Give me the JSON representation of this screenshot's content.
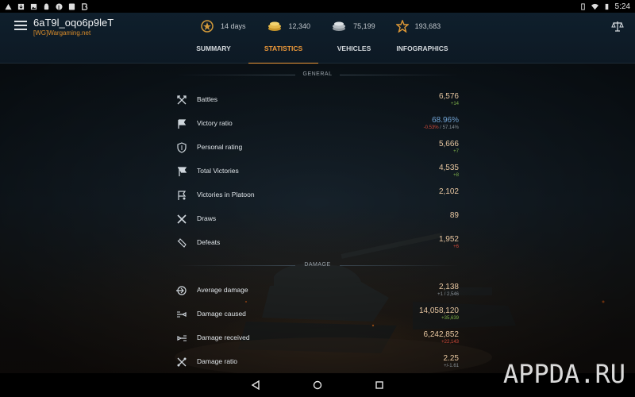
{
  "status_bar": {
    "time": "5:24",
    "icons": [
      "warning-icon",
      "download-icon",
      "image-icon",
      "android-icon",
      "pinterest-icon",
      "file-icon",
      "bitcoin-icon"
    ],
    "right_icons": [
      "vibrate-icon",
      "wifi-icon",
      "battery-icon"
    ]
  },
  "header": {
    "player_name": "6aT9l_oqo6p9leT",
    "clan": "[WG]Wargaming.net",
    "stats": [
      {
        "icon": "premium-icon",
        "value": "14 days"
      },
      {
        "icon": "gold-icon",
        "value": "12,340"
      },
      {
        "icon": "silver-icon",
        "value": "75,199"
      },
      {
        "icon": "star-icon",
        "value": "193,683"
      }
    ],
    "tabs": {
      "summary": "SUMMARY",
      "statistics": "STATISTICS",
      "vehicles": "VEHICLES",
      "infographics": "INFOGRAPHICS"
    }
  },
  "sections": {
    "general": "GENERAL",
    "damage": "DAMAGE"
  },
  "general_rows": [
    {
      "label": "Battles",
      "value": "6,576",
      "sub": "+14",
      "sub_color": "green",
      "icon": "battles-icon"
    },
    {
      "label": "Victory ratio",
      "value": "68.96%",
      "sub_a": "-0.53%",
      "sub_b": " / 57.14%",
      "icon": "flag-icon"
    },
    {
      "label": "Personal rating",
      "value": "5,666",
      "sub": "+7",
      "sub_color": "green",
      "icon": "shield-icon"
    },
    {
      "label": "Total Victories",
      "value": "4,535",
      "sub": "+8",
      "sub_color": "green",
      "icon": "victory-flag-icon"
    },
    {
      "label": "Victories in Platoon",
      "value": "2,102",
      "sub": "",
      "icon": "platoon-icon"
    },
    {
      "label": "Draws",
      "value": "89",
      "sub": "",
      "icon": "draws-icon"
    },
    {
      "label": "Defeats",
      "value": "1,952",
      "sub": "+6",
      "sub_color": "red",
      "icon": "defeat-icon"
    }
  ],
  "damage_rows": [
    {
      "label": "Average damage",
      "value": "2,138",
      "sub": "+1 / 2,546",
      "sub_color": "grey",
      "icon": "target-icon"
    },
    {
      "label": "Damage caused",
      "value": "14,058,120",
      "sub": "+35,639",
      "sub_color": "green",
      "icon": "shell-icon"
    },
    {
      "label": "Damage received",
      "value": "6,242,852",
      "sub": "+22,143",
      "sub_color": "red",
      "icon": "hit-icon"
    },
    {
      "label": "Damage ratio",
      "value": "2.25",
      "sub": "+/-1.61",
      "sub_color": "grey",
      "icon": "ratio-icon"
    }
  ],
  "nav": [
    "back-icon",
    "home-icon",
    "recents-icon"
  ],
  "watermark": "APPDA.RU",
  "colors": {
    "accent": "#ef9a3a",
    "value": "#e7c6a0",
    "blue": "#6fa0d0",
    "green": "#7fb24a",
    "red": "#d24a3a"
  }
}
